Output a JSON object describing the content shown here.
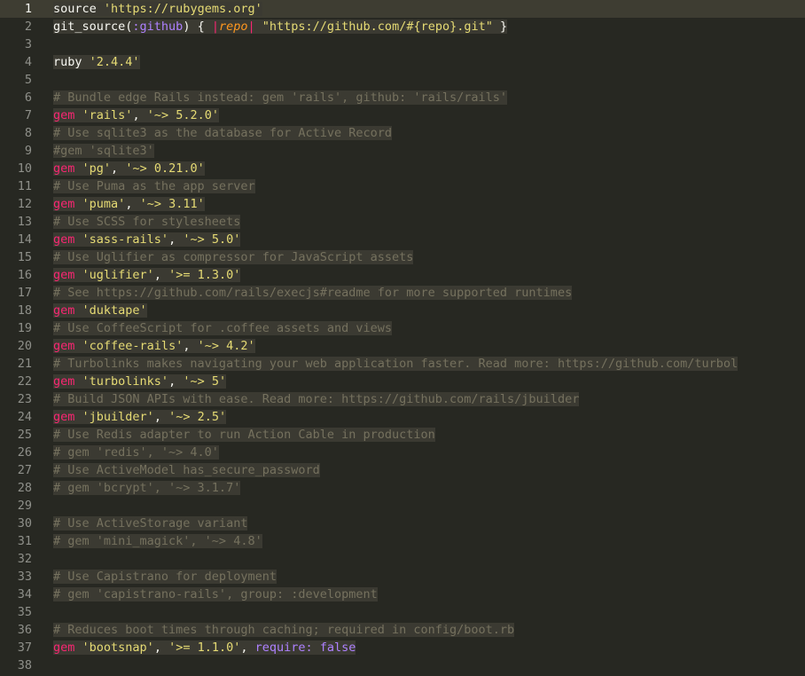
{
  "editor": {
    "file_language": "Ruby Gemfile",
    "lines": [
      {
        "n": "1",
        "tokens": [
          [
            "plain",
            "source "
          ],
          [
            "str",
            "'https://rubygems.org'"
          ]
        ]
      },
      {
        "n": "2",
        "tokens": [
          [
            "plain",
            "git_source("
          ],
          [
            "sym",
            ":github"
          ],
          [
            "plain",
            ") { "
          ],
          [
            "kw",
            "|"
          ],
          [
            "param",
            "repo"
          ],
          [
            "kw",
            "|"
          ],
          [
            "plain",
            " "
          ],
          [
            "str",
            "\"https://github.com/#{repo}.git\""
          ],
          [
            "plain",
            " }"
          ]
        ]
      },
      {
        "n": "3",
        "tokens": []
      },
      {
        "n": "4",
        "tokens": [
          [
            "plain",
            "ruby "
          ],
          [
            "str",
            "'2.4.4'"
          ]
        ]
      },
      {
        "n": "5",
        "tokens": []
      },
      {
        "n": "6",
        "tokens": [
          [
            "comment",
            "# Bundle edge Rails instead: gem 'rails', github: 'rails/rails'"
          ]
        ]
      },
      {
        "n": "7",
        "tokens": [
          [
            "kw",
            "gem"
          ],
          [
            "plain",
            " "
          ],
          [
            "str",
            "'rails'"
          ],
          [
            "plain",
            ", "
          ],
          [
            "str",
            "'~> 5.2.0'"
          ]
        ]
      },
      {
        "n": "8",
        "tokens": [
          [
            "comment",
            "# Use sqlite3 as the database for Active Record"
          ]
        ]
      },
      {
        "n": "9",
        "tokens": [
          [
            "comment",
            "#gem 'sqlite3'"
          ]
        ]
      },
      {
        "n": "10",
        "tokens": [
          [
            "kw",
            "gem"
          ],
          [
            "plain",
            " "
          ],
          [
            "str",
            "'pg'"
          ],
          [
            "plain",
            ", "
          ],
          [
            "str",
            "'~> 0.21.0'"
          ]
        ]
      },
      {
        "n": "11",
        "tokens": [
          [
            "comment",
            "# Use Puma as the app server"
          ]
        ]
      },
      {
        "n": "12",
        "tokens": [
          [
            "kw",
            "gem"
          ],
          [
            "plain",
            " "
          ],
          [
            "str",
            "'puma'"
          ],
          [
            "plain",
            ", "
          ],
          [
            "str",
            "'~> 3.11'"
          ]
        ]
      },
      {
        "n": "13",
        "tokens": [
          [
            "comment",
            "# Use SCSS for stylesheets"
          ]
        ]
      },
      {
        "n": "14",
        "tokens": [
          [
            "kw",
            "gem"
          ],
          [
            "plain",
            " "
          ],
          [
            "str",
            "'sass-rails'"
          ],
          [
            "plain",
            ", "
          ],
          [
            "str",
            "'~> 5.0'"
          ]
        ]
      },
      {
        "n": "15",
        "tokens": [
          [
            "comment",
            "# Use Uglifier as compressor for JavaScript assets"
          ]
        ]
      },
      {
        "n": "16",
        "tokens": [
          [
            "kw",
            "gem"
          ],
          [
            "plain",
            " "
          ],
          [
            "str",
            "'uglifier'"
          ],
          [
            "plain",
            ", "
          ],
          [
            "str",
            "'>= 1.3.0'"
          ]
        ]
      },
      {
        "n": "17",
        "tokens": [
          [
            "comment",
            "# See https://github.com/rails/execjs#readme for more supported runtimes"
          ]
        ]
      },
      {
        "n": "18",
        "tokens": [
          [
            "kw",
            "gem"
          ],
          [
            "plain",
            " "
          ],
          [
            "str",
            "'duktape'"
          ]
        ]
      },
      {
        "n": "19",
        "tokens": [
          [
            "comment",
            "# Use CoffeeScript for .coffee assets and views"
          ]
        ]
      },
      {
        "n": "20",
        "tokens": [
          [
            "kw",
            "gem"
          ],
          [
            "plain",
            " "
          ],
          [
            "str",
            "'coffee-rails'"
          ],
          [
            "plain",
            ", "
          ],
          [
            "str",
            "'~> 4.2'"
          ]
        ]
      },
      {
        "n": "21",
        "tokens": [
          [
            "comment",
            "# Turbolinks makes navigating your web application faster. Read more: https://github.com/turbol"
          ]
        ]
      },
      {
        "n": "22",
        "tokens": [
          [
            "kw",
            "gem"
          ],
          [
            "plain",
            " "
          ],
          [
            "str",
            "'turbolinks'"
          ],
          [
            "plain",
            ", "
          ],
          [
            "str",
            "'~> 5'"
          ]
        ]
      },
      {
        "n": "23",
        "tokens": [
          [
            "comment",
            "# Build JSON APIs with ease. Read more: https://github.com/rails/jbuilder"
          ]
        ]
      },
      {
        "n": "24",
        "tokens": [
          [
            "kw",
            "gem"
          ],
          [
            "plain",
            " "
          ],
          [
            "str",
            "'jbuilder'"
          ],
          [
            "plain",
            ", "
          ],
          [
            "str",
            "'~> 2.5'"
          ]
        ]
      },
      {
        "n": "25",
        "tokens": [
          [
            "comment",
            "# Use Redis adapter to run Action Cable in production"
          ]
        ]
      },
      {
        "n": "26",
        "tokens": [
          [
            "comment",
            "# gem 'redis', '~> 4.0'"
          ]
        ]
      },
      {
        "n": "27",
        "tokens": [
          [
            "comment",
            "# Use ActiveModel has_secure_password"
          ]
        ]
      },
      {
        "n": "28",
        "tokens": [
          [
            "comment",
            "# gem 'bcrypt', '~> 3.1.7'"
          ]
        ]
      },
      {
        "n": "29",
        "tokens": []
      },
      {
        "n": "30",
        "tokens": [
          [
            "comment",
            "# Use ActiveStorage variant"
          ]
        ]
      },
      {
        "n": "31",
        "tokens": [
          [
            "comment",
            "# gem 'mini_magick', '~> 4.8'"
          ]
        ]
      },
      {
        "n": "32",
        "tokens": []
      },
      {
        "n": "33",
        "tokens": [
          [
            "comment",
            "# Use Capistrano for deployment"
          ]
        ]
      },
      {
        "n": "34",
        "tokens": [
          [
            "comment",
            "# gem 'capistrano-rails', group: :development"
          ]
        ]
      },
      {
        "n": "35",
        "tokens": []
      },
      {
        "n": "36",
        "tokens": [
          [
            "comment",
            "# Reduces boot times through caching; required in config/boot.rb"
          ]
        ]
      },
      {
        "n": "37",
        "tokens": [
          [
            "kw",
            "gem"
          ],
          [
            "plain",
            " "
          ],
          [
            "str",
            "'bootsnap'"
          ],
          [
            "plain",
            ", "
          ],
          [
            "str",
            "'>= 1.1.0'"
          ],
          [
            "plain",
            ", "
          ],
          [
            "sym",
            "require:"
          ],
          [
            "plain",
            " "
          ],
          [
            "sym",
            "false"
          ]
        ]
      },
      {
        "n": "38",
        "tokens": []
      }
    ]
  },
  "colors": {
    "background": "#272822",
    "line_highlight": "#3e3d32",
    "selection": "#3b3a32",
    "plain": "#f8f8f2",
    "string": "#e6db74",
    "keyword": "#f92672",
    "comment": "#75715e",
    "symbol": "#ae81ff",
    "parameter": "#fd971f"
  }
}
